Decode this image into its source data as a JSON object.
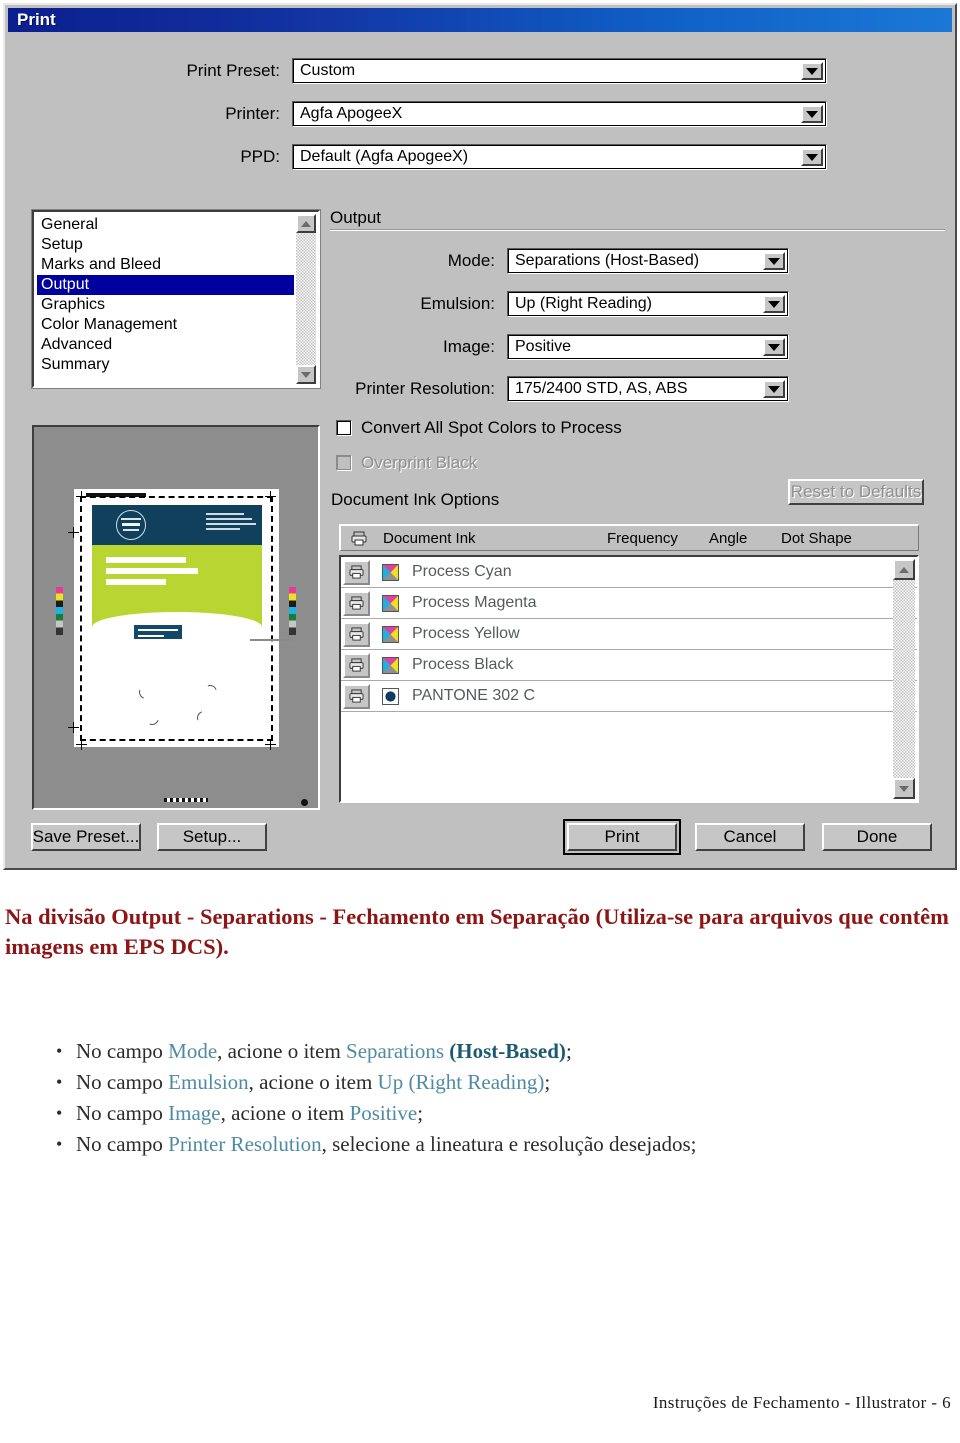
{
  "dialog": {
    "title": "Print",
    "top_fields": [
      {
        "label": "Print Preset:",
        "value": "Custom"
      },
      {
        "label": "Printer:",
        "value": "Agfa ApogeeX"
      },
      {
        "label": "PPD:",
        "value": "Default (Agfa ApogeeX)"
      }
    ],
    "nav_list": {
      "items": [
        "General",
        "Setup",
        "Marks and Bleed",
        "Output",
        "Graphics",
        "Color Management",
        "Advanced",
        "Summary"
      ],
      "selected": "Output"
    },
    "output_group": {
      "title": "Output",
      "fields": [
        {
          "label": "Mode:",
          "value": "Separations (Host-Based)"
        },
        {
          "label": "Emulsion:",
          "value": "Up (Right Reading)"
        },
        {
          "label": "Image:",
          "value": "Positive"
        },
        {
          "label": "Printer Resolution:",
          "value": "175/2400 STD, AS, ABS"
        }
      ],
      "checkboxes": [
        {
          "label": "Convert All Spot Colors to Process",
          "checked": false,
          "disabled": false
        },
        {
          "label": "Overprint Black",
          "checked": false,
          "disabled": true
        }
      ],
      "reset_button": "Reset to Defaults",
      "ink_options_title": "Document Ink Options",
      "ink_table": {
        "columns": [
          "Document Ink",
          "Frequency",
          "Angle",
          "Dot Shape"
        ],
        "rows": [
          {
            "name": "Process Cyan",
            "swatch": "cmyk-process-icon",
            "frequency": "",
            "angle": "",
            "dot_shape": ""
          },
          {
            "name": "Process Magenta",
            "swatch": "cmyk-process-icon",
            "frequency": "",
            "angle": "",
            "dot_shape": ""
          },
          {
            "name": "Process Yellow",
            "swatch": "cmyk-process-icon",
            "frequency": "",
            "angle": "",
            "dot_shape": ""
          },
          {
            "name": "Process Black",
            "swatch": "cmyk-process-icon",
            "frequency": "",
            "angle": "",
            "dot_shape": ""
          },
          {
            "name": "PANTONE 302 C",
            "swatch": "spot-color-icon",
            "frequency": "",
            "angle": "",
            "dot_shape": ""
          }
        ]
      }
    },
    "preview": {
      "headline_line1": "Você sabe qual",
      "headline_line2": "é o melhor lugar",
      "headline_line3": "do mundo?",
      "header_color": "#10405c",
      "body_color": "#b9d532"
    },
    "buttons": {
      "save_preset": "Save Preset...",
      "setup": "Setup...",
      "print": "Print",
      "cancel": "Cancel",
      "done": "Done"
    }
  },
  "document": {
    "heading": "Na divisão Output - Separations - Fechamento em Separação (Utiliza-se para arquivos que contêm imagens em EPS DCS).",
    "heading_color": "#8c1515",
    "bullets": [
      {
        "pre": "No campo ",
        "field": "Mode",
        "mid": ", acione o item ",
        "value": "Separations",
        "value_bold": " (Host-Based)",
        "post": ";"
      },
      {
        "pre": "No campo ",
        "field": "Emulsion",
        "mid": ", acione o item ",
        "value": "Up (Right Reading)",
        "value_bold": "",
        "post": ";"
      },
      {
        "pre": "No campo ",
        "field": "Image",
        "mid": ", acione o item ",
        "value": "Positive",
        "value_bold": "",
        "post": ";"
      },
      {
        "pre": "No campo ",
        "field": "Printer Resolution",
        "mid": ", selecione a lineatura e resolução desejados",
        "value": "",
        "value_bold": "",
        "post": ";"
      }
    ],
    "footer": "Instruções de Fechamento - Illustrator - 6"
  }
}
